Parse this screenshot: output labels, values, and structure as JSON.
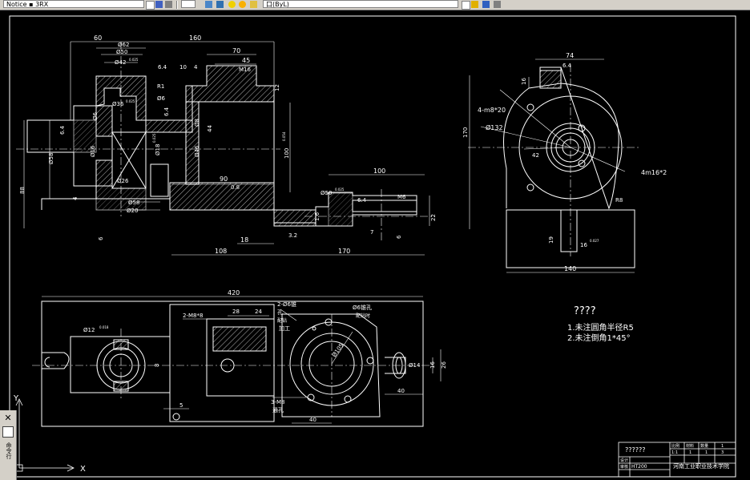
{
  "toolbar": {
    "layer_field_text": "Notice ▪ 3RX",
    "layer_state_text": "口(ByL)",
    "icons": [
      "layer-props-icon",
      "layer-prev-icon",
      "match-prop-icon",
      "lightbulb-icon",
      "sun-icon",
      "lock-icon",
      "layer-color-icon",
      "dropdown-icon",
      "layer-tools-icon"
    ]
  },
  "side_panel": {
    "close_glyph": "✕",
    "label": "命令行"
  },
  "ucs": {
    "y_label": "Y",
    "x_label": "X"
  },
  "front_view": {
    "dims": {
      "d60": "60",
      "d_phi62": "Ø62",
      "d_phi50": "Ø50",
      "d_phi42": "Ø42",
      "d_phi42_tol": "0.025",
      "d160": "160",
      "d70": "70",
      "d45": "45",
      "d_m16": "M16",
      "d6_4_top": "6.4",
      "d10": "10",
      "d4_top": "4",
      "d_r1": "R1",
      "d12": "12",
      "d_phi36": "Ø36",
      "d_phi36_tol": "0.025",
      "d_phi6": "Ø6",
      "d6_4_mid": "6.4",
      "d6_4_left": "6.4",
      "d_phi6_l": "Ø6",
      "d_phi8": "Ø8",
      "d44": "44",
      "d_phi16": "Ø16",
      "d_phi58_l": "Ø58",
      "d_phi18": "Ø18",
      "d_phi18_tol": "0.025",
      "d_phi46": "Ø46",
      "d100": "100",
      "d100_tol": "0.054",
      "d90": "90",
      "d_phi26": "Ø26",
      "d0_8": "0.8",
      "d_phi58": "Ø58",
      "d_phi20": "Ø20",
      "d88": "88",
      "d4_low": "4",
      "d6_low": "6",
      "d18": "18",
      "d108": "108",
      "d170": "170",
      "d3_2": "3.2",
      "d1_6": "1.6",
      "d100_r": "100",
      "d_phi50_r": "Ø50",
      "d_phi50_tol": "0.025",
      "d6_4_r": "6.4",
      "d_m6": "M6",
      "d22": "22",
      "d6_r": "6",
      "d7": "7"
    }
  },
  "side_view": {
    "dims": {
      "d74": "74",
      "d6_4": "6.4",
      "d16": "16",
      "d_4m8": "4-m8*20",
      "d170": "170",
      "d_phi132": "Ø132",
      "d42": "42",
      "d_4m16": "4m16*2",
      "d_r8": "R8",
      "d19": "19",
      "d16_b": "16",
      "d16_tol": "0.027",
      "d140": "140"
    }
  },
  "top_view": {
    "dims": {
      "d420": "420",
      "d_2m8": "2-M8*8",
      "d28": "28",
      "d24": "24",
      "d_2phi6": "2-Ø6锥",
      "d_hole": "孔",
      "d_pei": "配钻",
      "d_jia": "配钻时",
      "d_gong": "加工",
      "d_phi6_r": "Ø6锥孔",
      "d_pei_r": "配钻时",
      "d_phi105": "Ø105",
      "d_phi12": "Ø12",
      "d_phi12_tol": "0.018",
      "d8": "8",
      "d5": "5",
      "d_3m8": "3-M8",
      "d_tong": "通孔",
      "d40_b": "40",
      "d40_r": "40",
      "d_phi14": "Ø14",
      "d16": "16",
      "d26": "26"
    }
  },
  "notes": {
    "title": "????",
    "line1": "1.未注圆角半径R5",
    "line2": "2.未注倒角1*45°"
  },
  "title_block": {
    "drawing_name": "??????",
    "school": "河南工业职业技术学院",
    "row1": [
      "比例",
      "材料",
      "数量",
      "1"
    ],
    "row2": [
      "1:1",
      "1",
      "1",
      "3"
    ],
    "label_design": "设计",
    "label_check": "审核",
    "material": "HT200"
  }
}
